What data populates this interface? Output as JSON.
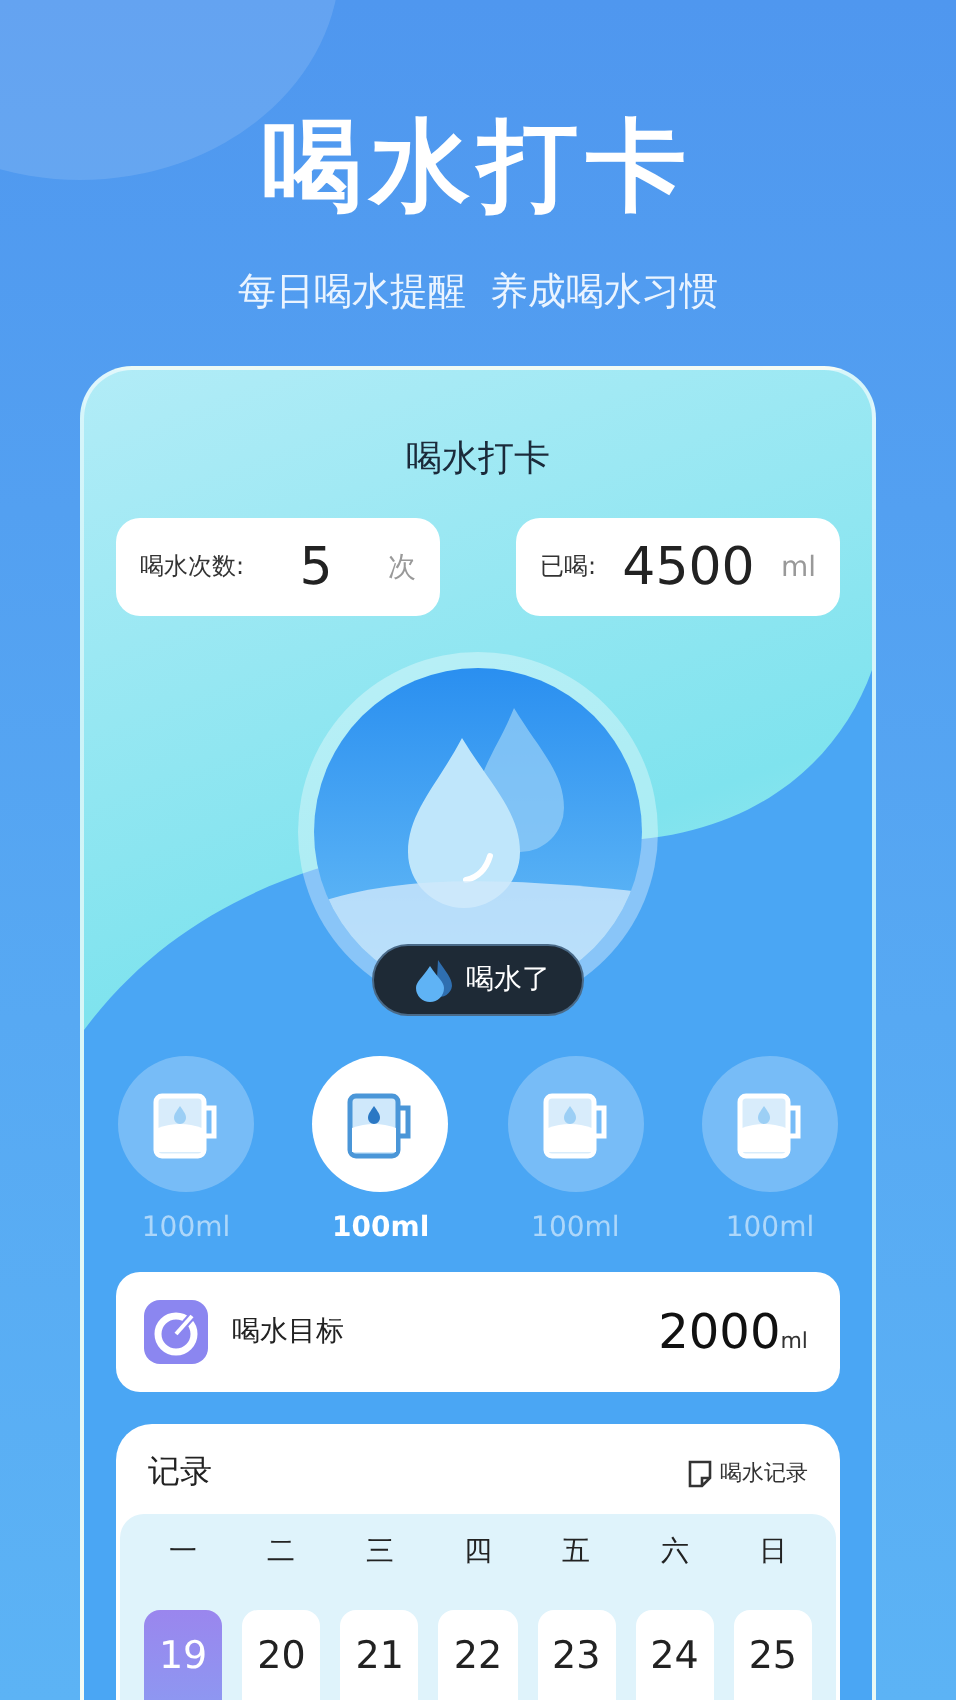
{
  "hero": {
    "title": "喝水打卡",
    "subtitle": "每日喝水提醒  养成喝水习惯"
  },
  "card": {
    "title": "喝水打卡",
    "stats": [
      {
        "label": "喝水次数:",
        "value": "5",
        "unit": "次"
      },
      {
        "label": "已喝:",
        "value": "4500",
        "unit": "ml"
      }
    ],
    "drink_button": "喝水了",
    "cups": [
      {
        "label": "100ml",
        "selected": false
      },
      {
        "label": "100ml",
        "selected": true
      },
      {
        "label": "100ml",
        "selected": false
      },
      {
        "label": "100ml",
        "selected": false
      }
    ],
    "goal": {
      "label": "喝水目标",
      "value": "2000",
      "unit": "ml"
    },
    "records": {
      "title": "记录",
      "link": "喝水记录",
      "weekdays": [
        "一",
        "二",
        "三",
        "四",
        "五",
        "六",
        "日"
      ],
      "days": [
        {
          "day": "19",
          "selected": true
        },
        {
          "day": "20",
          "selected": false
        },
        {
          "day": "21",
          "selected": false
        },
        {
          "day": "22",
          "selected": false
        },
        {
          "day": "23",
          "selected": false
        },
        {
          "day": "24",
          "selected": false
        },
        {
          "day": "25",
          "selected": false
        }
      ]
    }
  }
}
